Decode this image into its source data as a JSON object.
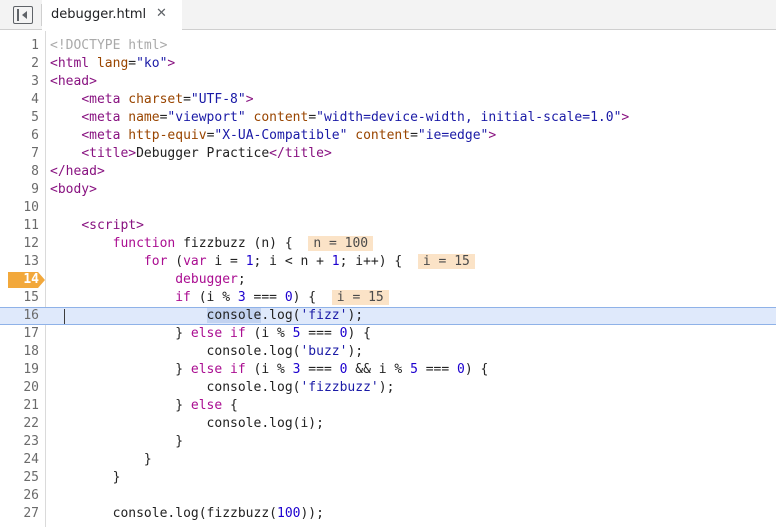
{
  "tab": {
    "filename": "debugger.html",
    "close_glyph": "✕",
    "toggle_icon": "sidebar-toggle-icon"
  },
  "editor": {
    "breakpoint_line": "14",
    "current_line": "16",
    "lines": [
      {
        "n": "1"
      },
      {
        "n": "2"
      },
      {
        "n": "3"
      },
      {
        "n": "4"
      },
      {
        "n": "5"
      },
      {
        "n": "6"
      },
      {
        "n": "7"
      },
      {
        "n": "8"
      },
      {
        "n": "9"
      },
      {
        "n": "10"
      },
      {
        "n": "11"
      },
      {
        "n": "12"
      },
      {
        "n": "13"
      },
      {
        "n": "14"
      },
      {
        "n": "15"
      },
      {
        "n": "16"
      },
      {
        "n": "17"
      },
      {
        "n": "18"
      },
      {
        "n": "19"
      },
      {
        "n": "20"
      },
      {
        "n": "21"
      },
      {
        "n": "22"
      },
      {
        "n": "23"
      },
      {
        "n": "24"
      },
      {
        "n": "25"
      },
      {
        "n": "26"
      },
      {
        "n": "27"
      }
    ],
    "code": {
      "l1": "<!DOCTYPE html>",
      "l2_open": "<html ",
      "l2_attr": "lang",
      "l2_eq": "=",
      "l2_val": "\"ko\"",
      "l2_close": ">",
      "l3": "<head>",
      "l4_indent": "    ",
      "l4_open": "<meta ",
      "l4_attr": "charset",
      "l4_eq": "=",
      "l4_val": "\"UTF-8\"",
      "l4_close": ">",
      "l5_indent": "    ",
      "l5_open": "<meta ",
      "l5_attr1": "name",
      "l5_eq1": "=",
      "l5_val1": "\"viewport\"",
      "l5_sp": " ",
      "l5_attr2": "content",
      "l5_eq2": "=",
      "l5_val2": "\"width=device-width, initial-scale=1.0\"",
      "l5_close": ">",
      "l6_indent": "    ",
      "l6_open": "<meta ",
      "l6_attr1": "http-equiv",
      "l6_eq1": "=",
      "l6_val1": "\"X-UA-Compatible\"",
      "l6_sp": " ",
      "l6_attr2": "content",
      "l6_eq2": "=",
      "l6_val2": "\"ie=edge\"",
      "l6_close": ">",
      "l7_indent": "    ",
      "l7_open": "<title>",
      "l7_text": "Debugger Practice",
      "l7_close": "</title>",
      "l8": "</head>",
      "l9": "<body>",
      "l11_indent": "    ",
      "l11": "<script>",
      "l12_indent": "        ",
      "l12_kw": "function",
      "l12_rest": " fizzbuzz (n) {  ",
      "l12_val": "n = 100",
      "l13_indent": "            ",
      "l13_kw1": "for",
      "l13_a": " (",
      "l13_kw2": "var",
      "l13_b": " i = ",
      "l13_n1": "1",
      "l13_c": "; i < n + ",
      "l13_n2": "1",
      "l13_d": "; i++) {  ",
      "l13_val": "i = 15",
      "l14_indent": "                ",
      "l14_kw": "debugger",
      "l14_rest": ";",
      "l15_indent": "                ",
      "l15_kw": "if",
      "l15_a": " (i % ",
      "l15_n1": "3",
      "l15_b": " === ",
      "l15_n2": "0",
      "l15_c": ") {  ",
      "l15_val": "i = 15",
      "l16_indent": "                    ",
      "l16_sel": "console",
      "l16_a": ".log(",
      "l16_str": "'fizz'",
      "l16_b": ");",
      "l17_indent": "                ",
      "l17_a": "} ",
      "l17_kw1": "else",
      "l17_sp": " ",
      "l17_kw2": "if",
      "l17_b": " (i % ",
      "l17_n1": "5",
      "l17_c": " === ",
      "l17_n2": "0",
      "l17_d": ") {",
      "l18_indent": "                    ",
      "l18_a": "console.log(",
      "l18_str": "'buzz'",
      "l18_b": ");",
      "l19_indent": "                ",
      "l19_a": "} ",
      "l19_kw1": "else",
      "l19_sp": " ",
      "l19_kw2": "if",
      "l19_b": " (i % ",
      "l19_n1": "3",
      "l19_c": " === ",
      "l19_n2": "0",
      "l19_d": " && i % ",
      "l19_n3": "5",
      "l19_e": " === ",
      "l19_n4": "0",
      "l19_f": ") {",
      "l20_indent": "                    ",
      "l20_a": "console.log(",
      "l20_str": "'fizzbuzz'",
      "l20_b": ");",
      "l21_indent": "                ",
      "l21_a": "} ",
      "l21_kw": "else",
      "l21_b": " {",
      "l22_indent": "                    ",
      "l22": "console.log(i);",
      "l23_indent": "                ",
      "l23": "}",
      "l24_indent": "            ",
      "l24": "}",
      "l25_indent": "        ",
      "l25": "}",
      "l27_indent": "        ",
      "l27_a": "console.log(fizzbuzz(",
      "l27_n": "100",
      "l27_b": "));"
    }
  }
}
